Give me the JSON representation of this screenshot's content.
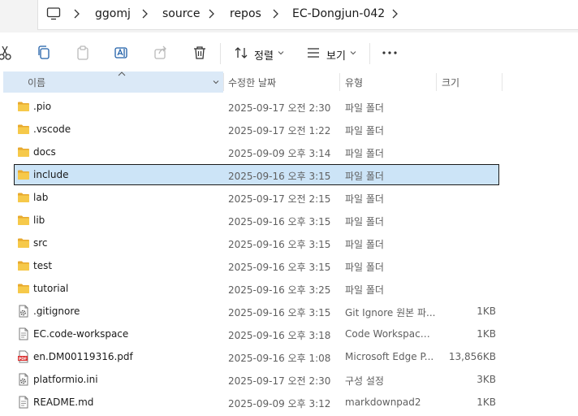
{
  "breadcrumb": [
    "ggomj",
    "source",
    "repos",
    "EC-Dongjun-042"
  ],
  "toolbar": {
    "sort_label": "정렬",
    "view_label": "보기"
  },
  "columns": {
    "name": "이름",
    "date": "수정한 날짜",
    "type": "유형",
    "size": "크기"
  },
  "files": [
    {
      "name": ".pio",
      "date": "2025-09-17 오전 2:30",
      "type": "파일 폴더",
      "size": "",
      "icon": "folder-icon"
    },
    {
      "name": ".vscode",
      "date": "2025-09-17 오전 1:22",
      "type": "파일 폴더",
      "size": "",
      "icon": "folder-icon"
    },
    {
      "name": "docs",
      "date": "2025-09-09 오후 3:14",
      "type": "파일 폴더",
      "size": "",
      "icon": "folder-icon"
    },
    {
      "name": "include",
      "date": "2025-09-16 오후 3:15",
      "type": "파일 폴더",
      "size": "",
      "icon": "folder-icon",
      "selected": true
    },
    {
      "name": "lab",
      "date": "2025-09-17 오전 2:15",
      "type": "파일 폴더",
      "size": "",
      "icon": "folder-icon"
    },
    {
      "name": "lib",
      "date": "2025-09-16 오후 3:15",
      "type": "파일 폴더",
      "size": "",
      "icon": "folder-icon"
    },
    {
      "name": "src",
      "date": "2025-09-16 오후 3:15",
      "type": "파일 폴더",
      "size": "",
      "icon": "folder-icon"
    },
    {
      "name": "test",
      "date": "2025-09-16 오후 3:15",
      "type": "파일 폴더",
      "size": "",
      "icon": "folder-icon"
    },
    {
      "name": "tutorial",
      "date": "2025-09-16 오후 3:25",
      "type": "파일 폴더",
      "size": "",
      "icon": "folder-icon"
    },
    {
      "name": ".gitignore",
      "date": "2025-09-16 오후 3:15",
      "type": "Git Ignore 원본 파...",
      "size": "1KB",
      "icon": "gear-file-icon"
    },
    {
      "name": "EC.code-workspace",
      "date": "2025-09-16 오후 3:18",
      "type": "Code Workspace ...",
      "size": "1KB",
      "icon": "file-icon"
    },
    {
      "name": "en.DM00119316.pdf",
      "date": "2025-09-16 오후 1:08",
      "type": "Microsoft Edge P...",
      "size": "13,856KB",
      "icon": "pdf-icon"
    },
    {
      "name": "platformio.ini",
      "date": "2025-09-17 오전 2:30",
      "type": "구성 설정",
      "size": "3KB",
      "icon": "gear-file-icon"
    },
    {
      "name": "README.md",
      "date": "2025-09-09 오후 3:12",
      "type": "markdownpad2",
      "size": "1KB",
      "icon": "file-icon"
    }
  ],
  "colors": {
    "selected_bg": "#cce4f7",
    "header_sorted_bg": "#dbe9f7",
    "folder": "#f4c542",
    "pdf": "#d92d2d"
  }
}
